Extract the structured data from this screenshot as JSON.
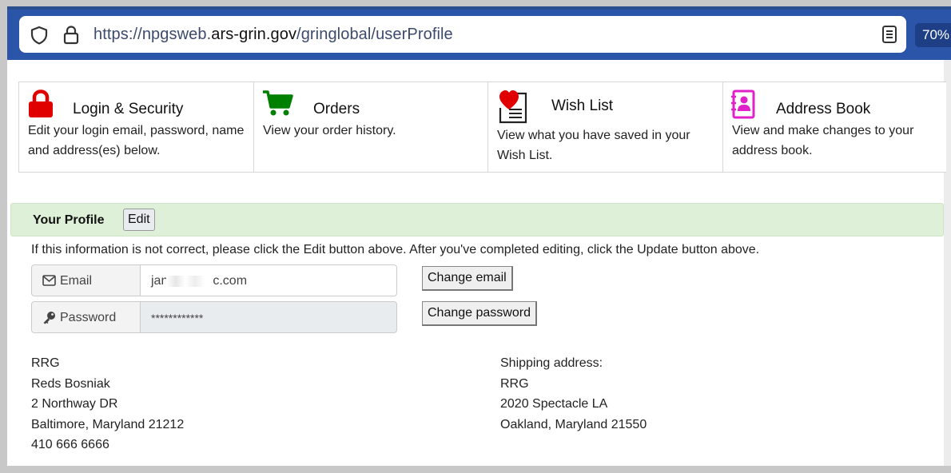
{
  "browser": {
    "url_prefix": "https://npgsweb.",
    "url_host": "ars-grin.gov",
    "url_path": "/gringlobal/userProfile",
    "zoom": "70%",
    "icons": [
      "shield-icon",
      "lock-icon",
      "reader-view-icon"
    ]
  },
  "cards": [
    {
      "title": "Login & Security",
      "desc": "Edit your login email, password, name and address(es) below.",
      "icon": "lock-icon",
      "color": "#e00000"
    },
    {
      "title": "Orders",
      "desc": "View your order history.",
      "icon": "cart-icon",
      "color": "#008000"
    },
    {
      "title": "Wish List",
      "desc": "View what you have saved in your Wish List.",
      "icon": "heart-list-icon",
      "color": "#e00000"
    },
    {
      "title": "Address Book",
      "desc": "View and make changes to your address book.",
      "icon": "contact-book-icon",
      "color": "#e020c8"
    }
  ],
  "profile": {
    "title": "Your Profile",
    "edit_label": "Edit",
    "info": "If this information is not correct, please click the Edit button above. After you've completed editing, click the Update button above.",
    "email_label": "Email",
    "email_value_start": "jan",
    "email_value_end": "c.com",
    "password_label": "Password",
    "password_value": "************",
    "change_email_label": "Change email",
    "change_password_label": "Change password"
  },
  "billing_address": [
    "RRG",
    "Reds Bosniak",
    "2 Northway DR",
    "Baltimore, Maryland 21212",
    "410 666 6666"
  ],
  "shipping_address": {
    "heading": "Shipping address:",
    "lines": [
      "RRG",
      "2020 Spectacle LA",
      "Oakland, Maryland 21550"
    ]
  },
  "colors": {
    "browser_bar": "#2a55a8",
    "profile_bar": "#dff0d8"
  }
}
